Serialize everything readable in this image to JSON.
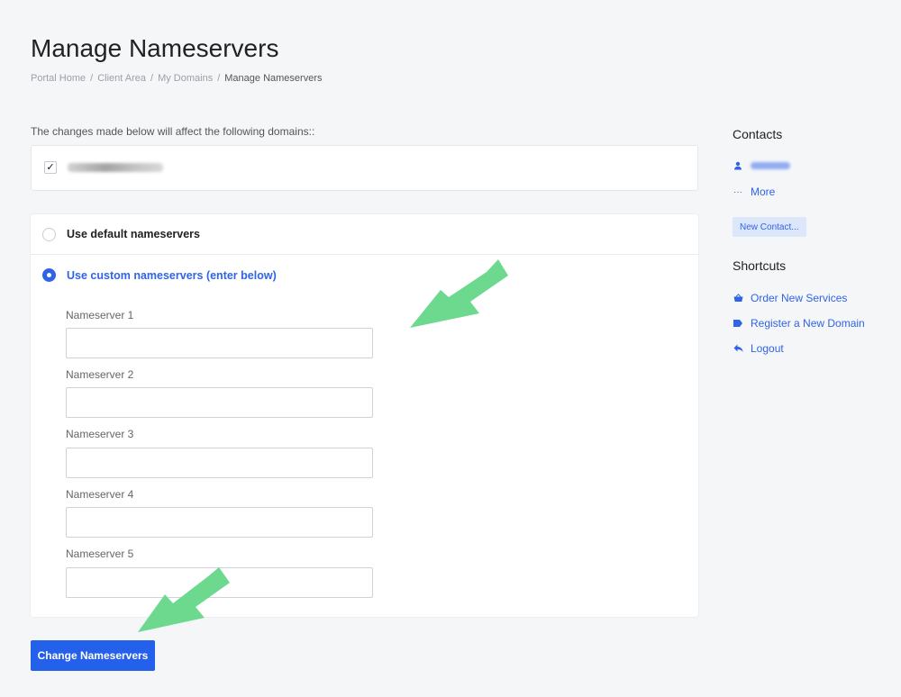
{
  "page": {
    "title": "Manage Nameservers",
    "breadcrumb": [
      "Portal Home",
      "Client Area",
      "My Domains"
    ],
    "breadcrumb_current": "Manage Nameservers"
  },
  "domains": {
    "notice": "The changes made below will affect the following domains::",
    "checked": true
  },
  "nameservers": {
    "default_label": "Use default nameservers",
    "custom_label": "Use custom nameservers (enter below)",
    "selected": "custom",
    "fields": [
      {
        "label": "Nameserver 1",
        "value": ""
      },
      {
        "label": "Nameserver 2",
        "value": ""
      },
      {
        "label": "Nameserver 3",
        "value": ""
      },
      {
        "label": "Nameserver 4",
        "value": ""
      },
      {
        "label": "Nameserver 5",
        "value": ""
      }
    ]
  },
  "submit_label": "Change Nameservers",
  "sidebar": {
    "contacts_heading": "Contacts",
    "more_label": "More",
    "new_contact_label": "New Contact...",
    "shortcuts_heading": "Shortcuts",
    "shortcuts": [
      {
        "label": "Order New Services",
        "icon": "basket-icon"
      },
      {
        "label": "Register a New Domain",
        "icon": "tag-icon"
      },
      {
        "label": "Logout",
        "icon": "logout-icon"
      }
    ]
  },
  "colors": {
    "accent": "#2f64e6",
    "button": "#2560ea",
    "annotation_arrow": "#6dd98f"
  }
}
